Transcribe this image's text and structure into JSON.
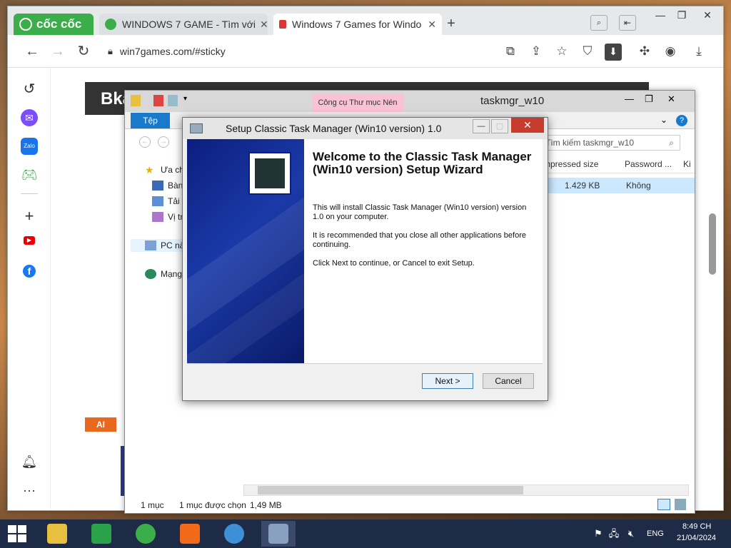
{
  "browser": {
    "brand": "cốc cốc",
    "tabs": [
      {
        "label": "WINDOWS 7 GAME - Tìm với",
        "close": "✕"
      },
      {
        "label": "Windows 7 Games for Windo",
        "close": "✕"
      }
    ],
    "new_tab": "+",
    "url": "win7games.com/#sticky",
    "window_controls": {
      "minimize": "—",
      "maximize": "❐",
      "close": "✕"
    }
  },
  "site": {
    "logo": "Bka",
    "ai_badge": "AI"
  },
  "explorer": {
    "context_tab": "Công cụ Thư mục Nén",
    "title": "taskmgr_w10",
    "file_tab": "Tệp",
    "search_placeholder": "Tìm kiếm taskmgr_w10",
    "columns": [
      "mpressed size",
      "Password ...",
      "Ki"
    ],
    "row": {
      "size": "1.429 KB",
      "password": "Không"
    },
    "nav_items": [
      {
        "label": "Ưa ch",
        "icon": "star-icon"
      },
      {
        "label": "Bàn",
        "icon": "desktop-icon"
      },
      {
        "label": "Tải x",
        "icon": "download-icon"
      },
      {
        "label": "Vị tr",
        "icon": "location-icon"
      },
      {
        "label": "PC nà",
        "icon": "computer-icon"
      },
      {
        "label": "Mạng",
        "icon": "network-icon"
      }
    ],
    "status": {
      "count": "1 mục",
      "selected": "1 mục được chọn",
      "size": "1,49 MB"
    }
  },
  "setup": {
    "title": "Setup Classic Task Manager (Win10 version) 1.0",
    "heading": "Welcome to the Classic Task Manager (Win10 version) Setup Wizard",
    "p1": "This will install Classic Task Manager (Win10 version) version 1.0 on your computer.",
    "p2": "It is recommended that you close all other applications before continuing.",
    "p3": "Click Next to continue, or Cancel to exit Setup.",
    "next": "Next >",
    "cancel": "Cancel"
  },
  "taskbar": {
    "tray": {
      "lang": "ENG",
      "time": "8:49 CH",
      "date": "21/04/2024"
    }
  },
  "colors": {
    "accent": "#1979ca",
    "brand": "#3cae49",
    "close": "#c83c2e"
  }
}
